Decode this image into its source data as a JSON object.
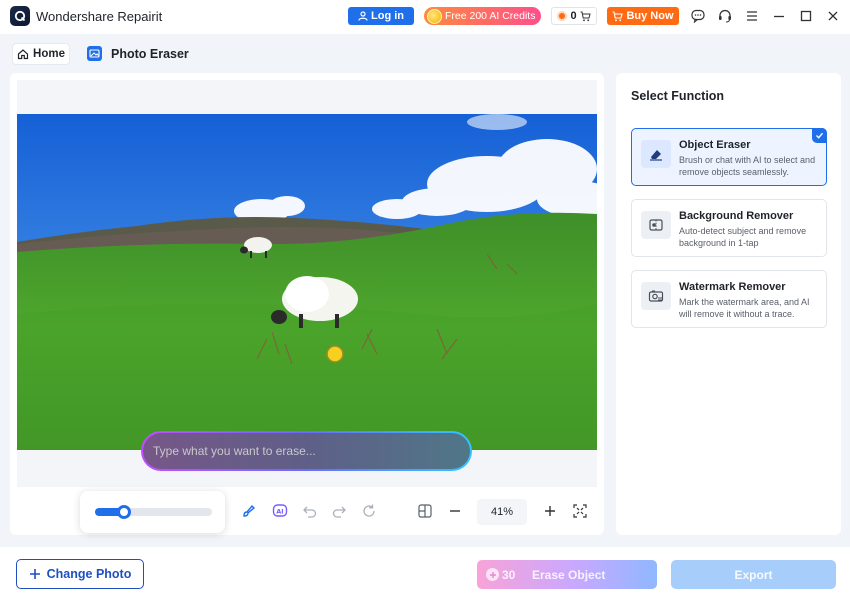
{
  "app": {
    "title": "Wondershare Repairit"
  },
  "titlebar": {
    "login_label": "Log in",
    "credits_label": "Free 200 AI Credits",
    "cart_count": "0",
    "buy_label": "Buy Now",
    "icons": [
      "chat-icon",
      "headset-icon",
      "menu-icon",
      "minimize-icon",
      "maximize-icon",
      "close-icon"
    ]
  },
  "header": {
    "home_label": "Home",
    "page_title": "Photo Eraser"
  },
  "canvas": {
    "prompt_placeholder": "Type what you want to erase..."
  },
  "toolbar": {
    "brush_size_fraction": 0.25,
    "zoom": "41%"
  },
  "functions": {
    "title": "Select Function",
    "items": [
      {
        "title": "Object Eraser",
        "desc": "Brush or chat with AI to select and remove objects seamlessly.",
        "selected": true
      },
      {
        "title": "Background Remover",
        "desc": "Auto-detect subject and remove background in 1-tap",
        "selected": false
      },
      {
        "title": "Watermark Remover",
        "desc": "Mark the watermark area, and AI will remove it without a trace.",
        "selected": false
      }
    ]
  },
  "bottom": {
    "change_photo_label": "Change Photo",
    "erase_credits": "30",
    "erase_label": "Erase Object",
    "export_label": "Export"
  },
  "colors": {
    "accent": "#1f6feb",
    "buy": "#ff6a13"
  }
}
